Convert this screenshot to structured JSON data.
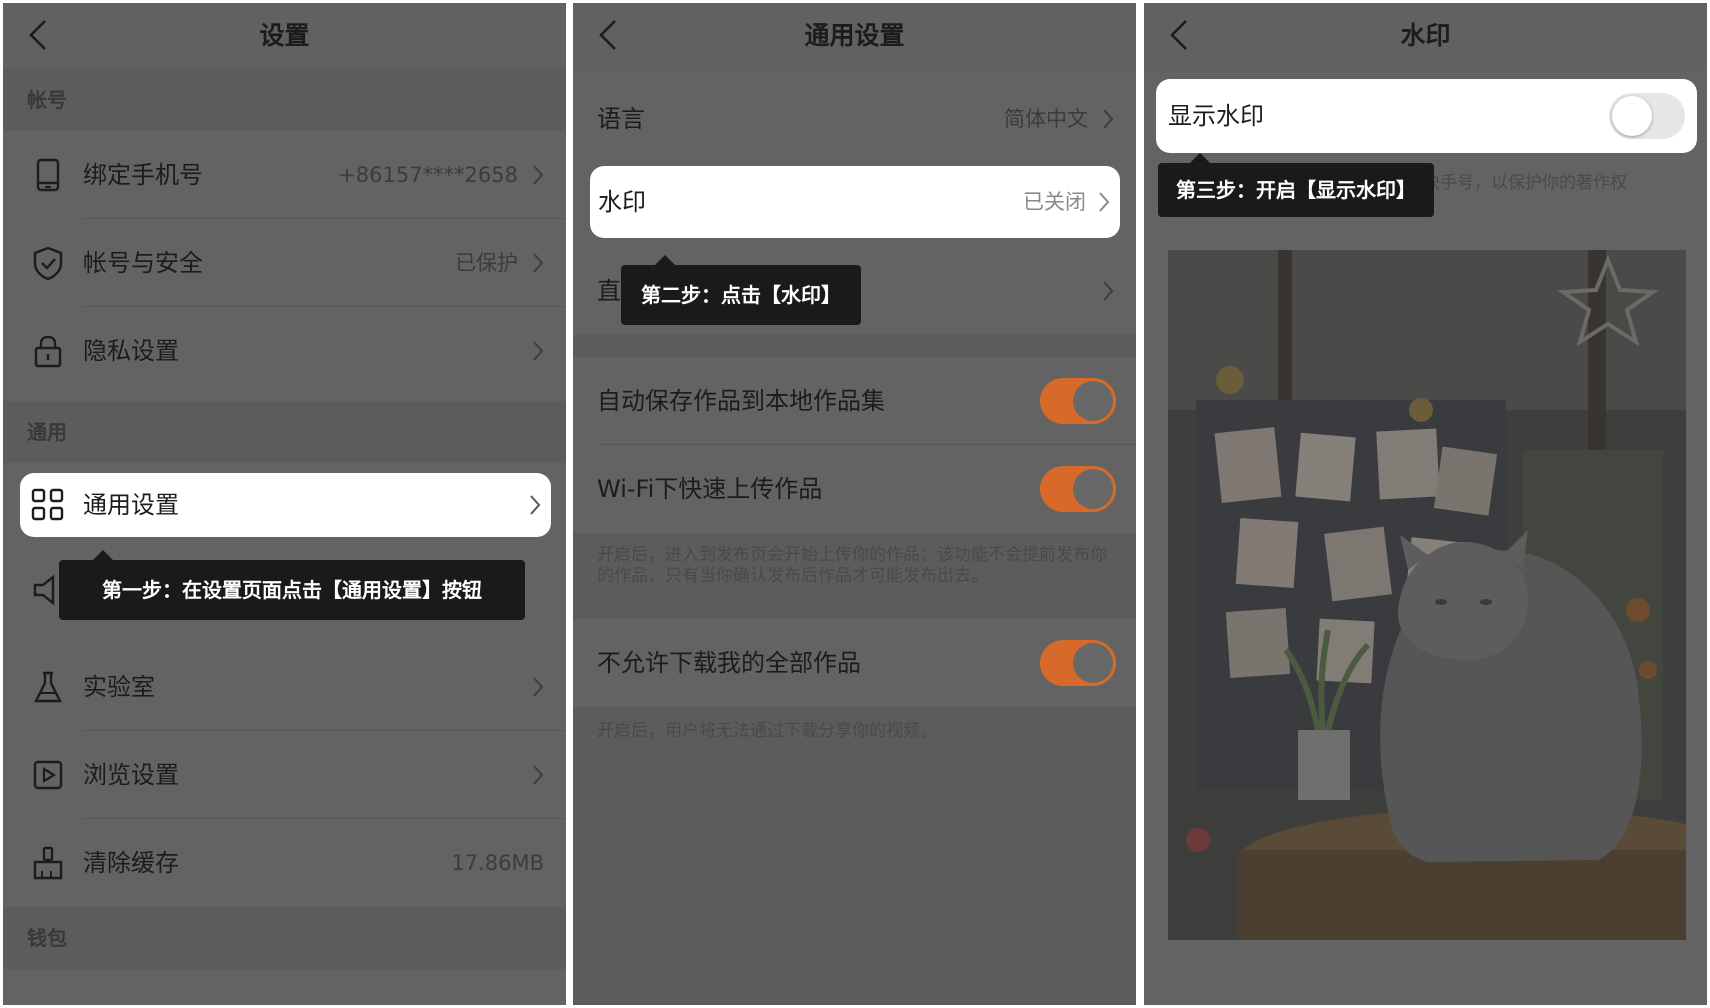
{
  "panels": {
    "settings": {
      "title": "设置",
      "sections": {
        "account": "帐号",
        "general": "通用",
        "wallet": "钱包"
      },
      "items": [
        {
          "label": "绑定手机号",
          "value": "+86157****2658",
          "icon": "phone-icon"
        },
        {
          "label": "帐号与安全",
          "value": "已保护",
          "icon": "shield-icon"
        },
        {
          "label": "隐私设置",
          "value": "",
          "icon": "lock-icon"
        },
        {
          "label": "通用设置",
          "value": "",
          "icon": "grid-icon"
        },
        {
          "label": "实验室",
          "value": "",
          "icon": "flask-icon"
        },
        {
          "label": "浏览设置",
          "value": "",
          "icon": "play-icon"
        },
        {
          "label": "清除缓存",
          "value": "17.86MB",
          "icon": "broom-icon"
        }
      ],
      "tip": "第一步：在设置页面点击【通用设置】按钮"
    },
    "general": {
      "title": "通用设置",
      "language": {
        "label": "语言",
        "value": "简体中文"
      },
      "watermark": {
        "label": "水印",
        "value": "已关闭"
      },
      "live": {
        "label": "直播"
      },
      "toggles": [
        {
          "label": "自动保存作品到本地作品集",
          "on": true
        },
        {
          "label": "Wi-Fi下快速上传作品",
          "on": true
        },
        {
          "label": "不允许下载我的全部作品",
          "on": true
        }
      ],
      "hint_upload": "开启后，进入到发布页会开始上传你的作品；该功能不会提前发布你的作品，只有当你确认发布后作品才可能发布出去。",
      "hint_download": "开启后，用户将无法通过下载分享你的视频。",
      "tip": "第二步：点击【水印】"
    },
    "watermark": {
      "title": "水印",
      "toggle": {
        "label": "显示水印",
        "on": false
      },
      "hint": "开启水印后，会在你的作品中显示快手号，以保护你的著作权",
      "tip": "第三步：开启【显示水印】"
    }
  },
  "colors": {
    "accent": "#d76a2a",
    "dim": "#636363",
    "tooltip": "#1a1a1a"
  }
}
